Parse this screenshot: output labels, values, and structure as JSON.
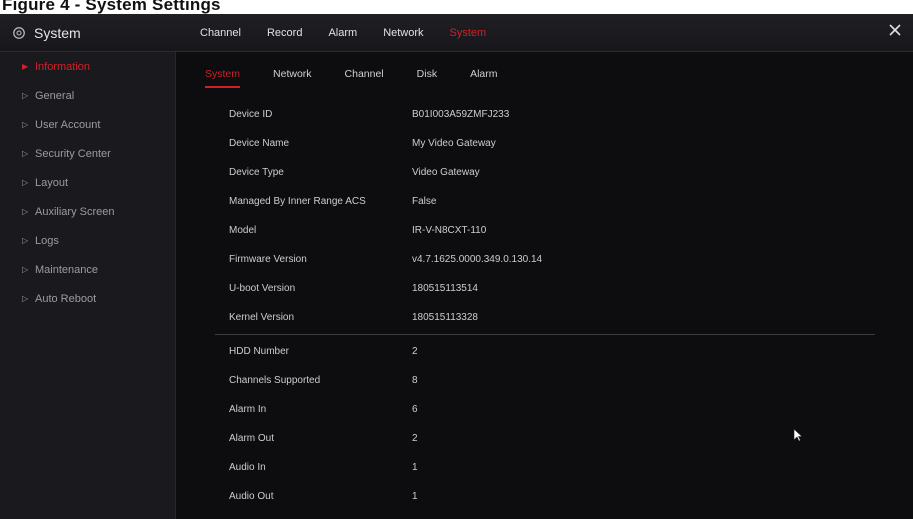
{
  "caption": "Figure 4 - System Settings",
  "brand": {
    "title": "System",
    "icon": "gear-icon"
  },
  "top_tabs": [
    {
      "label": "Channel",
      "active": false
    },
    {
      "label": "Record",
      "active": false
    },
    {
      "label": "Alarm",
      "active": false
    },
    {
      "label": "Network",
      "active": false
    },
    {
      "label": "System",
      "active": true
    }
  ],
  "close_icon": "close-icon",
  "sidebar": {
    "items": [
      {
        "label": "Information",
        "active": true
      },
      {
        "label": "General",
        "active": false
      },
      {
        "label": "User Account",
        "active": false
      },
      {
        "label": "Security Center",
        "active": false
      },
      {
        "label": "Layout",
        "active": false
      },
      {
        "label": "Auxiliary Screen",
        "active": false
      },
      {
        "label": "Logs",
        "active": false
      },
      {
        "label": "Maintenance",
        "active": false
      },
      {
        "label": "Auto Reboot",
        "active": false
      }
    ]
  },
  "sub_tabs": [
    {
      "label": "System",
      "active": true
    },
    {
      "label": "Network",
      "active": false
    },
    {
      "label": "Channel",
      "active": false
    },
    {
      "label": "Disk",
      "active": false
    },
    {
      "label": "Alarm",
      "active": false
    }
  ],
  "info_group_1": [
    {
      "label": "Device ID",
      "value": "B01I003A59ZMFJ233"
    },
    {
      "label": "Device Name",
      "value": "My Video Gateway"
    },
    {
      "label": "Device Type",
      "value": "Video Gateway"
    },
    {
      "label": "Managed By Inner Range ACS",
      "value": "False"
    },
    {
      "label": "Model",
      "value": "IR-V-N8CXT-110"
    },
    {
      "label": "Firmware Version",
      "value": "v4.7.1625.0000.349.0.130.14"
    },
    {
      "label": "U-boot Version",
      "value": "180515113514"
    },
    {
      "label": "Kernel Version",
      "value": "180515113328"
    }
  ],
  "info_group_2": [
    {
      "label": "HDD Number",
      "value": "2"
    },
    {
      "label": "Channels Supported",
      "value": "8"
    },
    {
      "label": "Alarm In",
      "value": "6"
    },
    {
      "label": "Alarm Out",
      "value": "2"
    },
    {
      "label": "Audio In",
      "value": "1"
    },
    {
      "label": "Audio Out",
      "value": "1"
    }
  ],
  "colors": {
    "accent": "#d0202a",
    "background": "#0d0d0f",
    "sidebar": "#1a1a1e",
    "topbar": "#1f1f24"
  }
}
